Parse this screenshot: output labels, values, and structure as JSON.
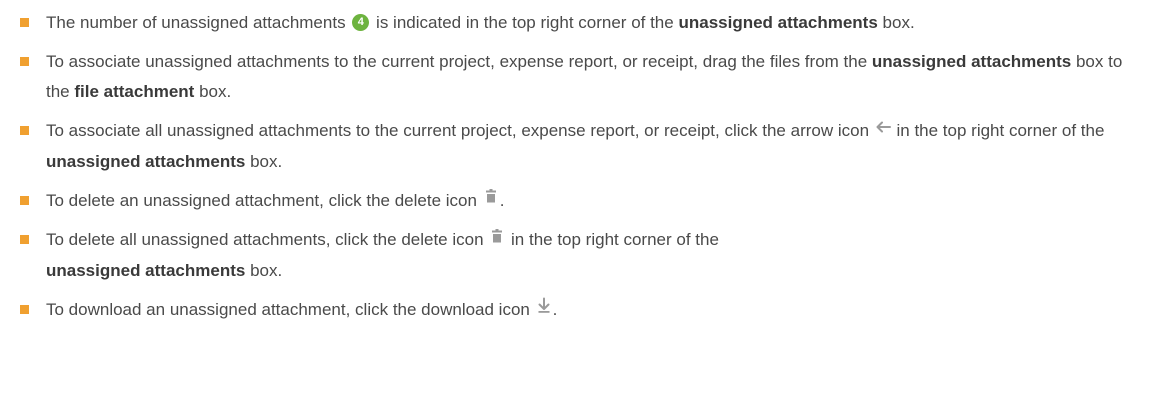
{
  "colors": {
    "bullet": "#f0a030",
    "badge": "#6db33f",
    "icon_gray": "#9a9a9a"
  },
  "icons": {
    "badge": "number-badge-icon",
    "arrow": "arrow-left-icon",
    "delete": "trash-icon",
    "download": "download-arrow-icon"
  },
  "items": [
    {
      "t1": "The number of unassigned attachments",
      "badge": "4",
      "t2": "is indicated in the top right corner of the",
      "b1": "unassigned attachments",
      "t3": "box."
    },
    {
      "t1": "To associate unassigned attachments to the current project, expense report, or receipt, drag the files from the",
      "b1": "unassigned attachments",
      "t2": "box to the",
      "b2": "file attachment",
      "t3": "box."
    },
    {
      "t1": "To associate all unassigned attachments to the current project, expense report, or receipt, click the arrow icon",
      "t2": "in the top right corner of the",
      "b1": "unassigned attachments",
      "t3": "box."
    },
    {
      "t1": "To delete an unassigned attachment, click the delete icon",
      "t2": "."
    },
    {
      "t1": "To delete all unassigned attachments, click the delete icon",
      "t2": "in the top right corner of the",
      "b1": "unassigned attachments",
      "t3": "box."
    },
    {
      "t1": "To download an unassigned attachment, click the download icon",
      "t2": "."
    }
  ]
}
